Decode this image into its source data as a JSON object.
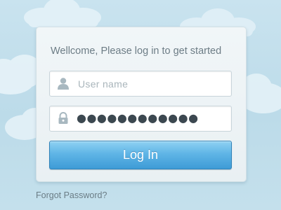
{
  "login_card": {
    "welcome_text": "Wellcome, Please log in to get started",
    "username": {
      "placeholder": "User  name",
      "icon": "user-icon"
    },
    "password": {
      "value_masked": "●●●●●●●●●●●●",
      "icon": "lock-icon"
    },
    "login_button_label": "Log In"
  },
  "forgot_password_link": "Forgot Password?",
  "colors": {
    "background": "#c5e0ec",
    "button_top": "#8fd1f2",
    "button_bottom": "#3e9bd6",
    "text_muted": "#6d7d86"
  }
}
